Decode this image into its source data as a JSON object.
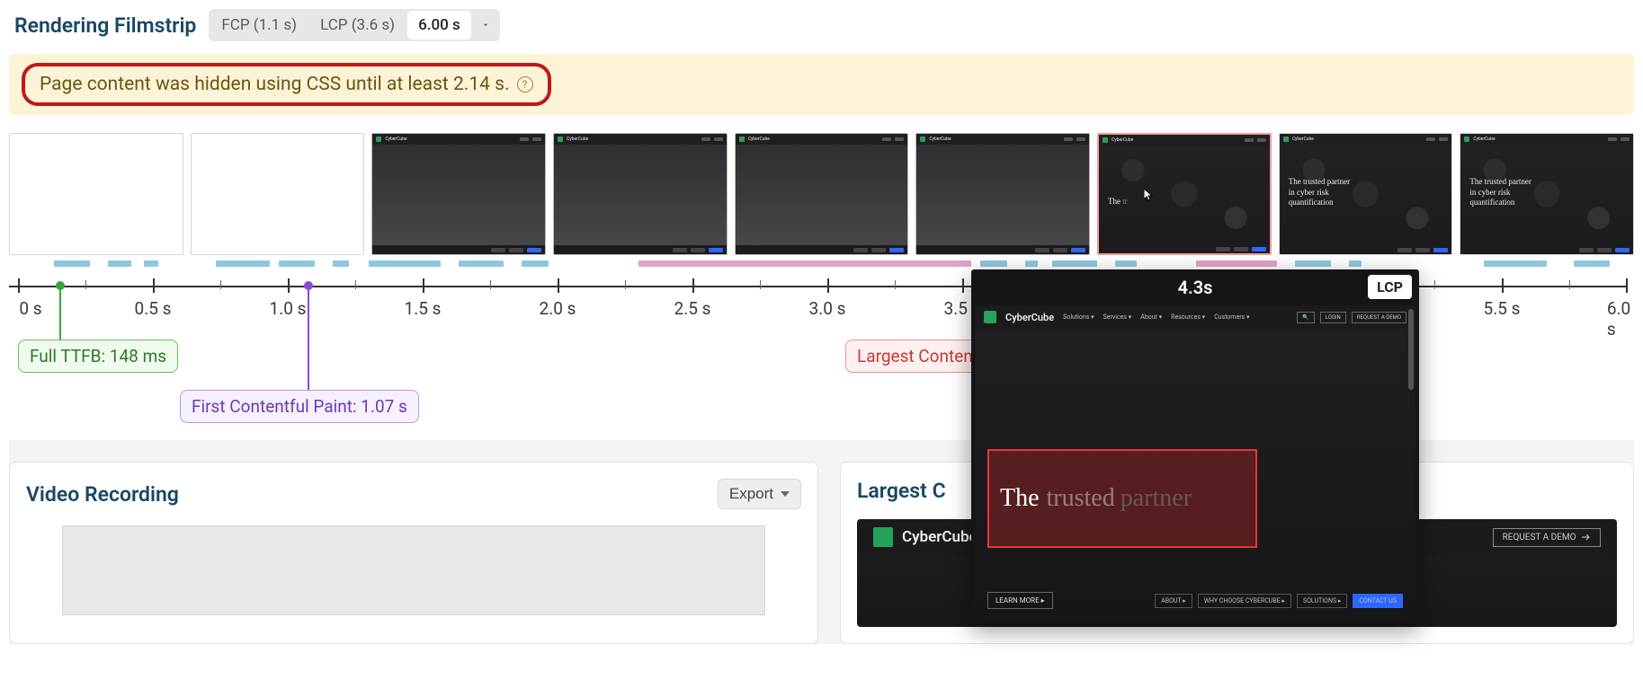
{
  "header": {
    "title": "Rendering Filmstrip",
    "fcp_pill": "FCP (1.1 s)",
    "lcp_pill": "LCP (3.6 s)",
    "time_selected": "6.00 s"
  },
  "warning": {
    "text": "Page content was hidden using CSS until at least 2.14 s."
  },
  "filmstrip": {
    "frames": [
      {
        "kind": "blank"
      },
      {
        "kind": "blank"
      },
      {
        "kind": "dark_nav"
      },
      {
        "kind": "dark_nav"
      },
      {
        "kind": "dark_nav"
      },
      {
        "kind": "dark_nav"
      },
      {
        "kind": "hex_partial",
        "text_a": "The",
        "text_b": "tr",
        "lcp": true,
        "cursor": true
      },
      {
        "kind": "hex_full",
        "line1": "The trusted partner",
        "line2": "in cyber risk",
        "line3": "quantification"
      },
      {
        "kind": "hex_full",
        "line1": "The trusted partner",
        "line2": "in cyber risk",
        "line3": "quantification"
      }
    ]
  },
  "timeline": {
    "ticks": [
      {
        "label": "0 s",
        "pos": 10
      },
      {
        "label": "0.5 s",
        "pos": 160
      },
      {
        "label": "1.0 s",
        "pos": 310
      },
      {
        "label": "1.5 s",
        "pos": 460
      },
      {
        "label": "2.0 s",
        "pos": 610
      },
      {
        "label": "2.5 s",
        "pos": 760
      },
      {
        "label": "3.0 s",
        "pos": 910
      },
      {
        "label": "3.5 s",
        "pos": 1060
      },
      {
        "label": "5.5 s",
        "pos": 1660
      },
      {
        "label": "6.0 s",
        "pos": 1810
      }
    ],
    "markers": {
      "ttfb": {
        "label": "Full TTFB: 148 ms",
        "pos": 56
      },
      "fcp": {
        "label": "First Contentful Paint: 1.07 s",
        "pos": 332
      },
      "lcp": {
        "label": "Largest Conten",
        "pos": 1040
      }
    }
  },
  "lcp_popup": {
    "time": "4.3s",
    "badge": "LCP",
    "brand": "CyberCube",
    "nav": [
      "Solutions ▾",
      "Services ▾",
      "About ▾",
      "Resources ▾",
      "Customers ▾"
    ],
    "login": "LOGIN",
    "request": "REQUEST A DEMO",
    "hero_words": {
      "w1": "The",
      "w2": "trusted",
      "w3": "partner"
    },
    "learn": "LEARN MORE ▸",
    "footer_btns": [
      "ABOUT ▸",
      "WHY CHOOSE CYBERCUBE ▸",
      "SOLUTIONS ▸"
    ],
    "contact": "CONTACT US"
  },
  "panels": {
    "video": {
      "title": "Video Recording",
      "export": "Export"
    },
    "lcp_section": {
      "title": "Largest C",
      "brand": "CyberCube",
      "request": "REQUEST A DEMO"
    }
  }
}
